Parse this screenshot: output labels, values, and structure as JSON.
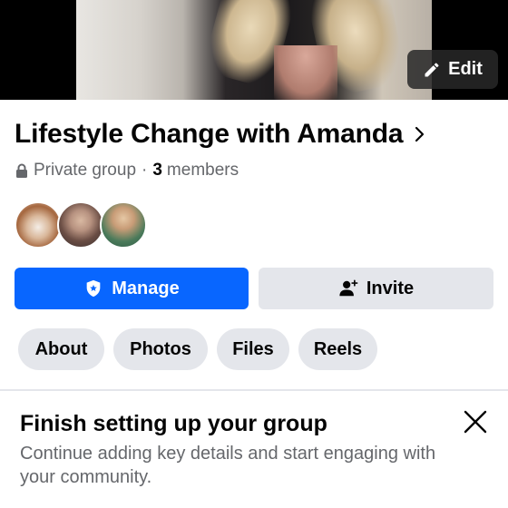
{
  "cover": {
    "edit_label": "Edit"
  },
  "group": {
    "title": "Lifestyle Change with Amanda",
    "privacy": "Private group",
    "separator": "·",
    "member_count": "3",
    "members_label": "members"
  },
  "actions": {
    "manage_label": "Manage",
    "invite_label": "Invite"
  },
  "tabs": [
    {
      "label": "About"
    },
    {
      "label": "Photos"
    },
    {
      "label": "Files"
    },
    {
      "label": "Reels"
    }
  ],
  "setup_card": {
    "title": "Finish setting up your group",
    "description": "Continue adding key details and start engaging with your community."
  },
  "colors": {
    "primary": "#0866ff",
    "secondary_button": "#e4e6eb",
    "text_primary": "#050505",
    "text_secondary": "#65676b"
  },
  "icons": {
    "edit": "pencil-icon",
    "title_chevron": "chevron-right-icon",
    "privacy": "lock-icon",
    "manage": "shield-star-icon",
    "invite": "person-add-icon",
    "close": "close-icon"
  }
}
